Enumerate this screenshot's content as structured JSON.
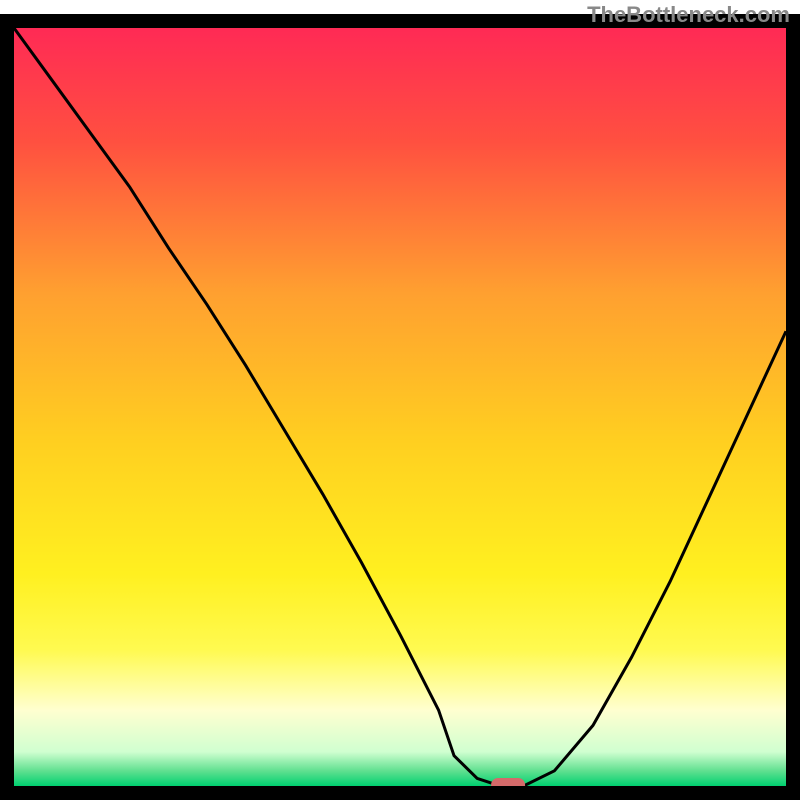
{
  "watermark": "TheBottleneck.com",
  "chart_data": {
    "type": "line",
    "title": "",
    "xlabel": "",
    "ylabel": "",
    "xlim": [
      0,
      100
    ],
    "ylim": [
      0,
      100
    ],
    "x": [
      0,
      5,
      10,
      15,
      20,
      25,
      30,
      35,
      40,
      45,
      50,
      55,
      57,
      60,
      63,
      66,
      70,
      75,
      80,
      85,
      90,
      95,
      100
    ],
    "values": [
      100,
      93,
      86,
      79,
      71,
      63.5,
      55.5,
      47,
      38.5,
      29.5,
      20,
      10,
      4,
      1,
      0,
      0,
      2,
      8,
      17,
      27,
      38,
      49,
      60
    ],
    "marker": {
      "x": 64,
      "y": 0,
      "color": "#d46a6a",
      "shape": "rounded_rect"
    },
    "background": {
      "type": "vertical_gradient",
      "stops": [
        {
          "pos": 0.0,
          "color": "#ff2a55"
        },
        {
          "pos": 0.15,
          "color": "#ff5040"
        },
        {
          "pos": 0.35,
          "color": "#ffa030"
        },
        {
          "pos": 0.55,
          "color": "#ffd020"
        },
        {
          "pos": 0.72,
          "color": "#fff020"
        },
        {
          "pos": 0.82,
          "color": "#fffa50"
        },
        {
          "pos": 0.9,
          "color": "#ffffd0"
        },
        {
          "pos": 0.955,
          "color": "#d0ffd0"
        },
        {
          "pos": 0.98,
          "color": "#60e090"
        },
        {
          "pos": 1.0,
          "color": "#00d070"
        }
      ]
    },
    "border": {
      "color": "#000000",
      "width": 14
    }
  }
}
